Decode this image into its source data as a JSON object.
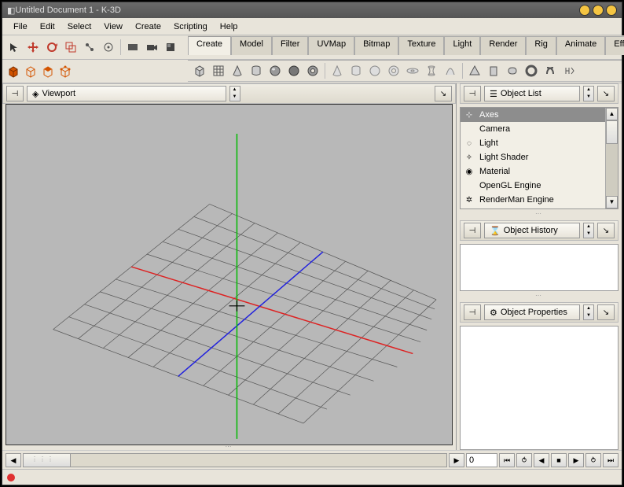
{
  "window": {
    "title": "Untitled Document 1 - K-3D"
  },
  "menu": [
    "File",
    "Edit",
    "Select",
    "View",
    "Create",
    "Scripting",
    "Help"
  ],
  "tabs": [
    "Create",
    "Model",
    "Filter",
    "UVMap",
    "Bitmap",
    "Texture",
    "Light",
    "Render",
    "Rig",
    "Animate",
    "Effects"
  ],
  "active_tab": 0,
  "viewport": {
    "label": "Viewport"
  },
  "object_list": {
    "title": "Object List",
    "items": [
      {
        "icon": "axes-icon",
        "label": "Axes",
        "selected": true
      },
      {
        "icon": "camera-icon",
        "label": "Camera"
      },
      {
        "icon": "light-icon",
        "label": "Light"
      },
      {
        "icon": "light-shader-icon",
        "label": "Light Shader"
      },
      {
        "icon": "material-icon",
        "label": "Material"
      },
      {
        "icon": "engine-icon",
        "label": "OpenGL Engine"
      },
      {
        "icon": "engine-icon",
        "label": "RenderMan Engine"
      }
    ]
  },
  "object_history": {
    "title": "Object History"
  },
  "object_properties": {
    "title": "Object Properties"
  },
  "timeline": {
    "frame": "0"
  }
}
